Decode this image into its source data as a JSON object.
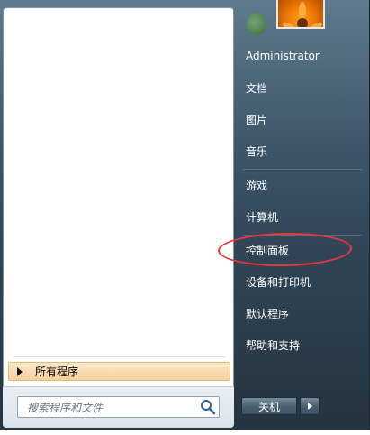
{
  "left_pane": {
    "all_programs_label": "所有程序",
    "search_placeholder": "搜索程序和文件"
  },
  "right_pane": {
    "user_name": "Administrator",
    "items": [
      {
        "label": "文档"
      },
      {
        "label": "图片"
      },
      {
        "label": "音乐"
      },
      {
        "label": "游戏"
      },
      {
        "label": "计算机"
      },
      {
        "label": "控制面板"
      },
      {
        "label": "设备和打印机"
      },
      {
        "label": "默认程序"
      },
      {
        "label": "帮助和支持"
      }
    ],
    "shutdown_label": "关机"
  },
  "colors": {
    "accent_highlight": "#e8363c",
    "panel_dark": "#2f4455",
    "all_programs_bg": "#f6d09e"
  },
  "icons": {
    "all_programs": "right-triangle-icon",
    "search": "magnifier-icon",
    "shutdown_options": "right-triangle-icon"
  }
}
